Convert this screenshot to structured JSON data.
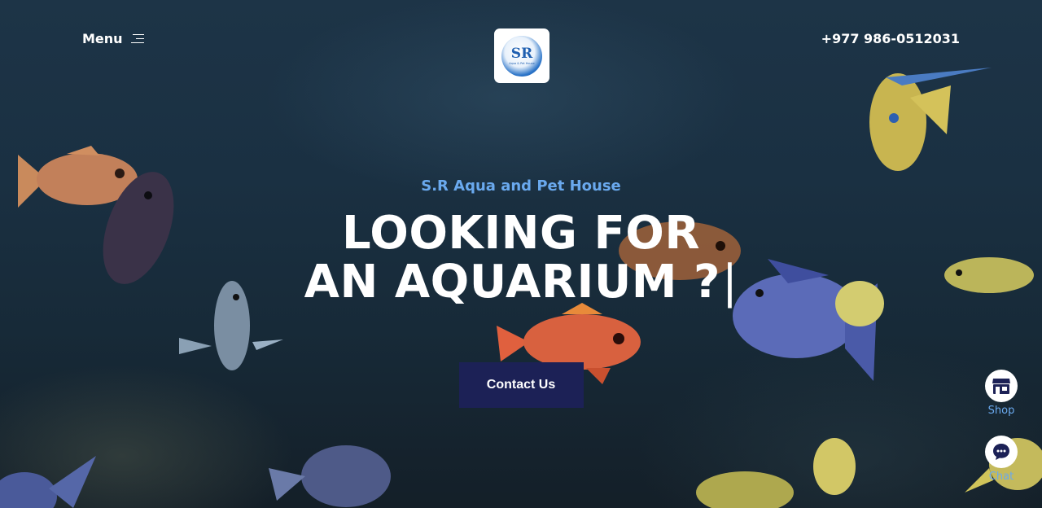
{
  "header": {
    "menu_label": "Menu",
    "menu_icon": "hamburger-icon",
    "logo_text": "SR",
    "logo_subtext": "Aqua & Pet House",
    "phone": "+977 986-0512031"
  },
  "hero": {
    "subtitle": "S.R Aqua and Pet House",
    "headline_line1": "LOOKING FOR",
    "headline_line2": "AN AQUARIUM ?",
    "cursor": "|",
    "cta_label": "Contact Us"
  },
  "floating": {
    "shop_label": "Shop",
    "shop_icon": "storefront-icon",
    "chat_label": "Chat",
    "chat_icon": "chat-bubble-icon"
  },
  "colors": {
    "accent": "#6aa9ee",
    "button_bg": "#1c2156",
    "water_dark": "#16283a"
  }
}
